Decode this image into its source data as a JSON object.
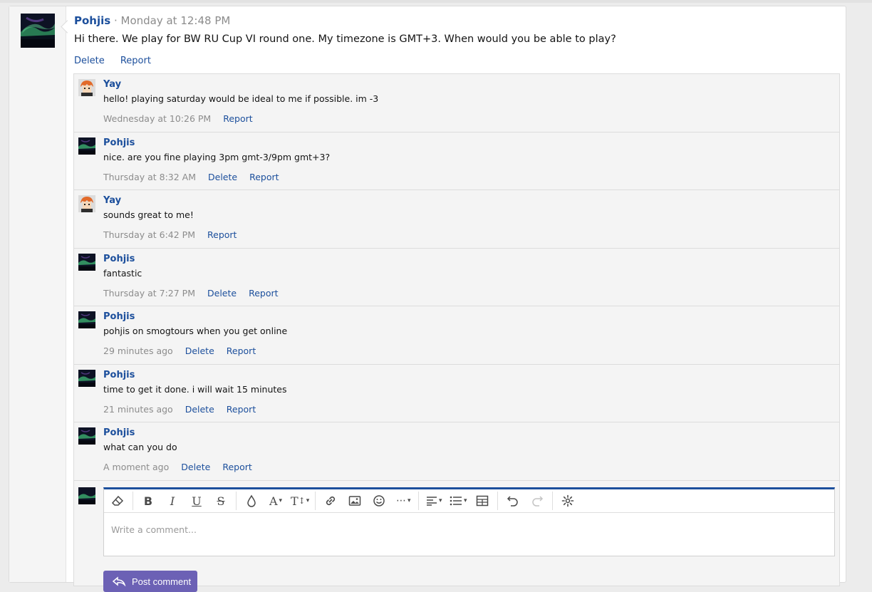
{
  "post": {
    "author": "Pohjis",
    "meta": " · Monday at 12:48 PM",
    "text": "Hi there. We play for BW RU Cup VI round one. My timezone is GMT+3. When would you be able to play?",
    "actions": [
      "Delete",
      "Report"
    ]
  },
  "comments": [
    {
      "author": "Yay",
      "avatar": "orange-hair-avatar",
      "text": "hello! playing saturday would be ideal to me if possible. im -3",
      "time": "Wednesday at 10:26 PM",
      "actions": [
        "Report"
      ]
    },
    {
      "author": "Pohjis",
      "avatar": "aurora-avatar",
      "text": "nice. are you fine playing 3pm gmt-3/9pm gmt+3?",
      "time": "Thursday at 8:32 AM",
      "actions": [
        "Delete",
        "Report"
      ]
    },
    {
      "author": "Yay",
      "avatar": "orange-hair-avatar",
      "text": "sounds great to me!",
      "time": "Thursday at 6:42 PM",
      "actions": [
        "Report"
      ]
    },
    {
      "author": "Pohjis",
      "avatar": "aurora-avatar",
      "text": "fantastic",
      "time": "Thursday at 7:27 PM",
      "actions": [
        "Delete",
        "Report"
      ]
    },
    {
      "author": "Pohjis",
      "avatar": "aurora-avatar",
      "text": "pohjis on smogtours when you get online",
      "time": "29 minutes ago",
      "actions": [
        "Delete",
        "Report"
      ]
    },
    {
      "author": "Pohjis",
      "avatar": "aurora-avatar",
      "text": "time to get it done. i will wait 15 minutes",
      "time": "21 minutes ago",
      "actions": [
        "Delete",
        "Report"
      ]
    },
    {
      "author": "Pohjis",
      "avatar": "aurora-avatar",
      "text": "what can you do",
      "time": "A moment ago",
      "actions": [
        "Delete",
        "Report"
      ]
    }
  ],
  "editor": {
    "placeholder": "Write a comment...",
    "submit_label": "Post comment",
    "toolbar": [
      "eraser-icon",
      "bold-icon",
      "italic-icon",
      "underline-icon",
      "strikethrough-icon",
      "text-color-icon",
      "font-family-icon",
      "font-size-icon",
      "link-icon",
      "image-icon",
      "emoji-icon",
      "more-icon",
      "align-icon",
      "list-icon",
      "table-icon",
      "undo-icon",
      "redo-icon",
      "settings-icon"
    ]
  },
  "colors": {
    "link": "#1c4f9c",
    "button": "#6c61b5",
    "accent_bar": "#1c4f9c"
  }
}
